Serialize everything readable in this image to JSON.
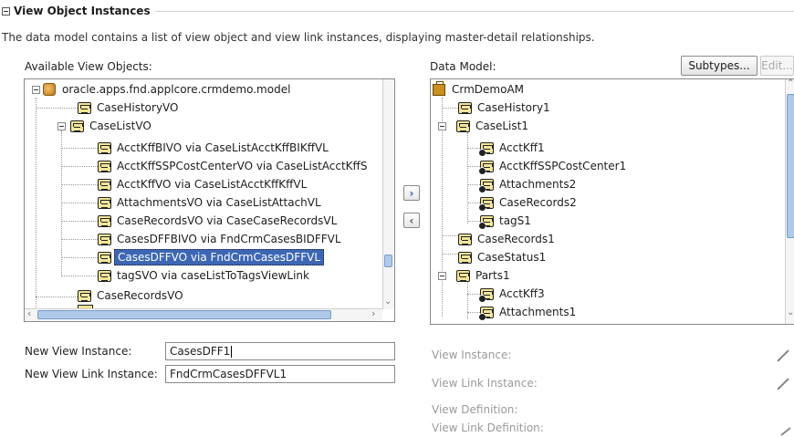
{
  "section": {
    "title": "View Object Instances",
    "description": "The data model contains a list of view object and view link instances, displaying master-detail relationships."
  },
  "available": {
    "label": "Available View Objects:",
    "items": [
      {
        "label": "oracle.apps.fnd.applcore.crmdemo.model",
        "icon": "package-icon"
      },
      {
        "label": "CaseHistoryVO",
        "icon": "view-object-icon"
      },
      {
        "label": "CaseListVO",
        "icon": "view-object-icon"
      },
      {
        "label": "AcctKffBIVO via CaseListAcctKffBIKffVL",
        "icon": "view-object-icon"
      },
      {
        "label": "AcctKffSSPCostCenterVO via CaseListAcctKffS",
        "icon": "view-object-icon"
      },
      {
        "label": "AcctKffVO via CaseListAcctKffKffVL",
        "icon": "view-object-icon"
      },
      {
        "label": "AttachmentsVO via CaseListAttachVL",
        "icon": "view-object-icon"
      },
      {
        "label": "CaseRecordsVO via CaseCaseRecordsVL",
        "icon": "view-object-icon"
      },
      {
        "label": "CasesDFFBIVO via FndCrmCasesBIDFFVL",
        "icon": "view-object-icon"
      },
      {
        "label": "CasesDFFVO via FndCrmCasesDFFVL",
        "icon": "view-object-icon",
        "selected": true
      },
      {
        "label": "tagSVO via caseListToTagsViewLink",
        "icon": "view-object-icon"
      },
      {
        "label": "CaseRecordsVO",
        "icon": "view-object-icon"
      }
    ]
  },
  "model": {
    "label": "Data Model:",
    "subtypes_button": "Subtypes...",
    "edit_button": "Edit...",
    "items": [
      {
        "label": "CrmDemoAM",
        "icon": "application-module-icon"
      },
      {
        "label": "CaseHistory1",
        "icon": "view-instance-icon"
      },
      {
        "label": "CaseList1",
        "icon": "view-instance-icon"
      },
      {
        "label": "AcctKff1",
        "icon": "view-link-instance-icon"
      },
      {
        "label": "AcctKffSSPCostCenter1",
        "icon": "view-link-instance-icon"
      },
      {
        "label": "Attachments2",
        "icon": "view-link-instance-icon"
      },
      {
        "label": "CaseRecords2",
        "icon": "view-link-instance-icon"
      },
      {
        "label": "tagS1",
        "icon": "view-link-instance-icon"
      },
      {
        "label": "CaseRecords1",
        "icon": "view-instance-icon"
      },
      {
        "label": "CaseStatus1",
        "icon": "view-instance-icon"
      },
      {
        "label": "Parts1",
        "icon": "view-instance-icon"
      },
      {
        "label": "AcctKff3",
        "icon": "view-link-instance-icon"
      },
      {
        "label": "Attachments1",
        "icon": "view-link-instance-icon"
      }
    ]
  },
  "shuttle": {
    "add": "›",
    "remove": "‹"
  },
  "form": {
    "view_instance_label": "New View Instance:",
    "view_instance_value": "CasesDFF1",
    "view_link_instance_label": "New View Link Instance:",
    "view_link_instance_value": "FndCrmCasesDFFVL1"
  },
  "details": {
    "view_instance": "View Instance:",
    "view_link_instance": "View Link Instance:",
    "view_definition": "View Definition:",
    "view_link_definition": "View Link Definition:"
  }
}
